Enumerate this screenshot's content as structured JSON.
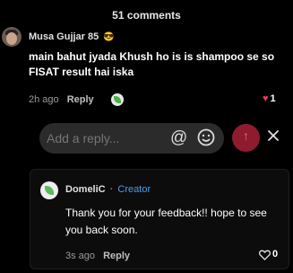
{
  "header": {
    "comment_count": "51 comments"
  },
  "comment1": {
    "author": "Musa Gujjar 85",
    "author_emoji": "😎",
    "text": "main bahut jyada Khush ho is is shampoo se so FISAT result hai iska",
    "time": "2h ago",
    "reply_label": "Reply",
    "likes": "1",
    "like_color": "#e83a5c"
  },
  "reply_box": {
    "placeholder": "Add a reply...",
    "icons": [
      "at-icon",
      "emoji-icon",
      "send-icon",
      "close-icon"
    ],
    "send_color": "#8e1c2e"
  },
  "comment2": {
    "author": "DomeliC",
    "separator": "·",
    "badge": "Creator",
    "badge_color": "#4a9fe8",
    "text": "Thank you for your feedback!! hope to see you back soon.",
    "time": "3s ago",
    "reply_label": "Reply",
    "likes": "0"
  }
}
